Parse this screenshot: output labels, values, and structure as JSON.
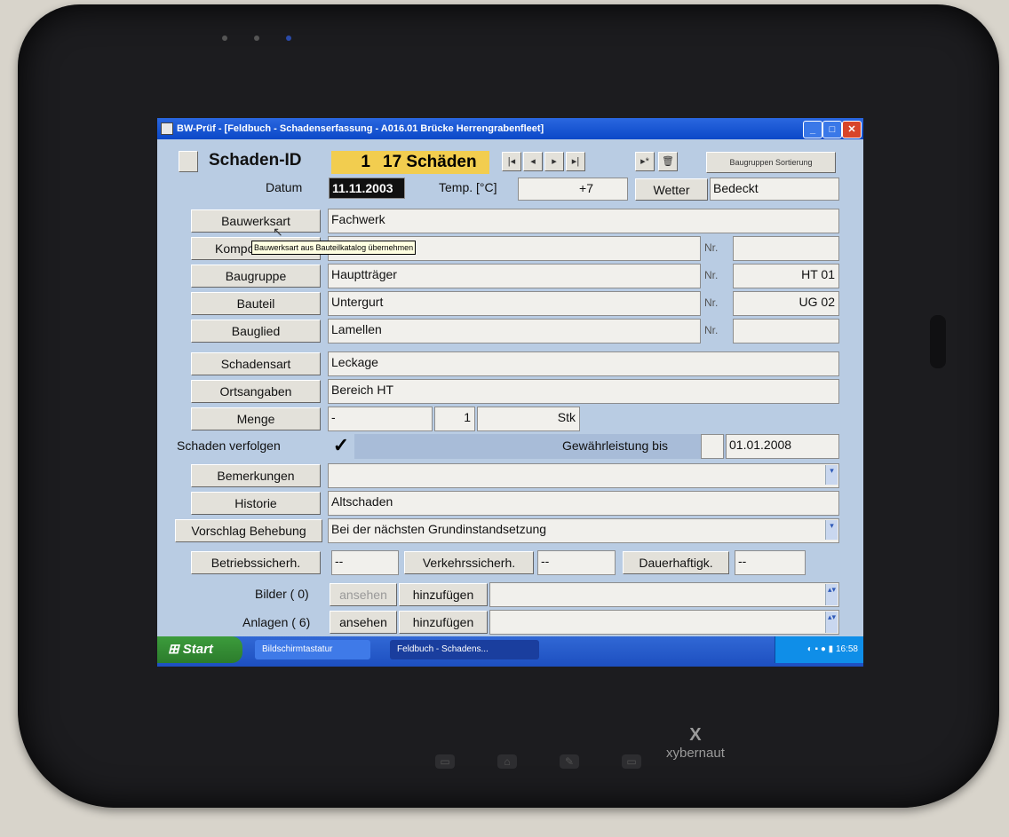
{
  "device": {
    "brand": "xybernaut",
    "logo": "X"
  },
  "window": {
    "title": "BW-Prüf - [Feldbuch - Schadenserfassung - A016.01 Brücke Herrengrabenfleet]"
  },
  "header": {
    "schaden_id_label": "Schaden-ID",
    "schaden_id_value": "1",
    "schaden_count": "17 Schäden",
    "nav_first": "|◂",
    "nav_prev": "◂",
    "nav_next": "▸",
    "nav_last": "▸|",
    "nav_new": "▸*",
    "nav_delete": "🗑",
    "baugruppen_sortierung": "Baugruppen Sortierung"
  },
  "datum": {
    "label": "Datum",
    "value": "11.11.2003"
  },
  "temp": {
    "label": "Temp. [°C]",
    "value": "+7"
  },
  "wetter": {
    "label": "Wetter",
    "value": "Bedeckt"
  },
  "rows": {
    "bauwerksart": {
      "label": "Bauwerksart",
      "value": "Fachwerk"
    },
    "komponente": {
      "label": "Kompon",
      "value": "",
      "nr": ""
    },
    "tooltip": "Bauwerksart aus Bauteilkatalog übernehmen",
    "baugruppe": {
      "label": "Baugruppe",
      "value": "Hauptträger",
      "nr": "HT 01"
    },
    "bauteil": {
      "label": "Bauteil",
      "value": "Untergurt",
      "nr": "UG 02"
    },
    "bauglied": {
      "label": "Bauglied",
      "value": "Lamellen",
      "nr": ""
    },
    "nr_label": "Nr.",
    "schadensart": {
      "label": "Schadensart",
      "value": "Leckage"
    },
    "ortsangaben": {
      "label": "Ortsangaben",
      "value": "Bereich HT"
    },
    "menge": {
      "label": "Menge",
      "value1": "-",
      "value2": "1",
      "unit": "Stk"
    },
    "verfolgen": {
      "label": "Schaden verfolgen",
      "check": "✓",
      "gewaehr_label": "Gewährleistung bis",
      "gewaehr_value": "01.01.2008"
    },
    "bemerkungen": {
      "label": "Bemerkungen",
      "value": ""
    },
    "historie": {
      "label": "Historie",
      "value": "Altschaden"
    },
    "vorschlag": {
      "label": "Vorschlag Behebung",
      "value": "Bei der nächsten Grundinstandsetzung"
    },
    "betriebs": {
      "label": "Betriebssicherh.",
      "value": "--"
    },
    "verkehrs": {
      "label": "Verkehrssicherh.",
      "value": "--"
    },
    "dauer": {
      "label": "Dauerhaftigk.",
      "value": "--"
    },
    "bilder": {
      "label": "Bilder ( 0)",
      "ansehen": "ansehen",
      "hinzufuegen": "hinzufügen"
    },
    "anlagen": {
      "label": "Anlagen ( 6)",
      "ansehen": "ansehen",
      "hinzufuegen": "hinzufügen"
    }
  },
  "taskbar": {
    "start": "Start",
    "task1": "Bildschirmtastatur",
    "task2": "Feldbuch - Schadens...",
    "clock": "16:58"
  },
  "colors": {
    "form_bg": "#b9cce3",
    "highlight": "#f2cd4f",
    "taskbar": "#1d4fc0"
  }
}
